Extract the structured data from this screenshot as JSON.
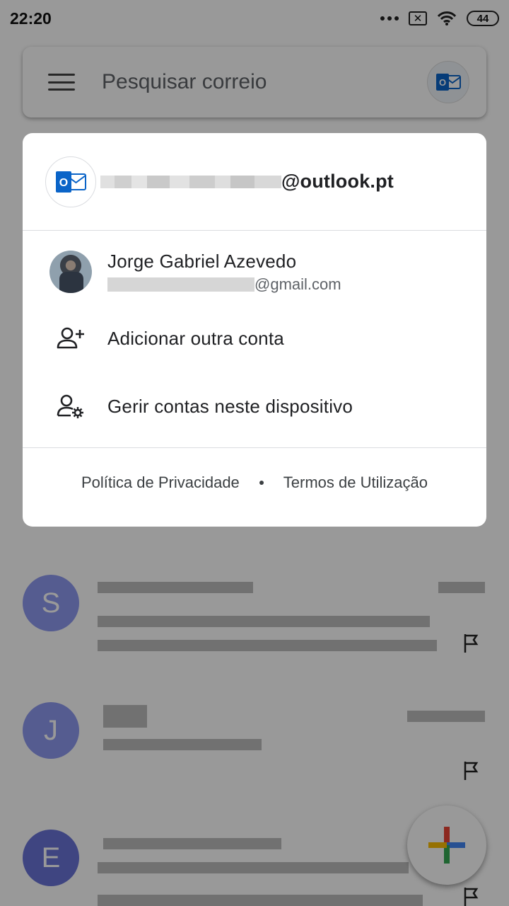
{
  "statusbar": {
    "time": "22:20",
    "battery": "44"
  },
  "search": {
    "placeholder": "Pesquisar correio"
  },
  "mails": [
    {
      "initial": "S",
      "color": "#8e99f0"
    },
    {
      "initial": "J",
      "color": "#8e99f0"
    },
    {
      "initial": "E",
      "color": "#6a74d8"
    }
  ],
  "sheet": {
    "current_account": {
      "email_domain": "@outlook.pt"
    },
    "other_account": {
      "name": "Jorge Gabriel Azevedo",
      "email_domain": "@gmail.com"
    },
    "actions": {
      "add_account": "Adicionar outra conta",
      "manage_accounts": "Gerir contas neste dispositivo"
    },
    "footer": {
      "privacy": "Política de Privacidade",
      "terms": "Termos de Utilização"
    }
  },
  "colors": {
    "outlook_blue": "#0a64c8",
    "accent": "#1a73e8"
  }
}
